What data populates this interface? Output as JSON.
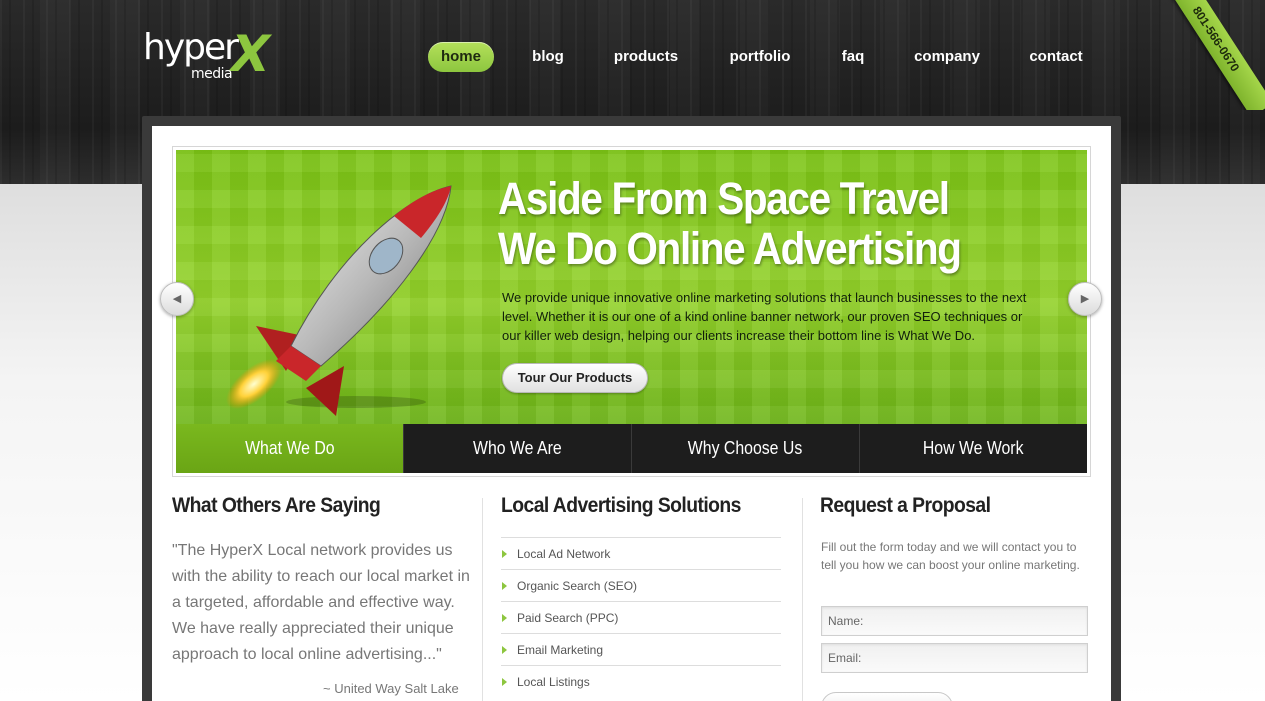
{
  "brand": {
    "logo_main": "hyper",
    "logo_x": "X",
    "logo_sub": "media",
    "phone": "801-566-0670",
    "accent_color": "#8dc63f"
  },
  "nav": {
    "items": [
      "home",
      "blog",
      "products",
      "portfolio",
      "faq",
      "company",
      "contact"
    ],
    "active": "home"
  },
  "slider": {
    "heading_line1": "Aside From Space Travel",
    "heading_line2": "We Do Online Advertising",
    "text": "We provide unique innovative online marketing solutions that launch businesses to the next level. Whether it is our one of a kind online banner network, our proven SEO techniques or our killer web design, helping our clients increase their bottom line is What We Do.",
    "button_label": "Tour Our Products",
    "prev_icon": "arrow-left-icon",
    "next_icon": "arrow-right-icon"
  },
  "tabs": [
    "What We Do",
    "Who We Are",
    "Why Choose Us",
    "How We Work"
  ],
  "testimonials": {
    "title": "What Others Are Saying",
    "quote": "\"The HyperX Local network provides us with the ability to reach our local market in a targeted, affordable and effective way. We have really appreciated their unique approach to local online advertising...\"",
    "source": "~ United Way Salt Lake"
  },
  "solutions": {
    "title": "Local Advertising Solutions",
    "items": [
      "Local Ad Network",
      "Organic Search (SEO)",
      "Paid Search (PPC)",
      "Email Marketing",
      "Local Listings"
    ]
  },
  "proposal": {
    "title": "Request a Proposal",
    "text": "Fill out the form today and we will contact you to tell you how we can boost your online marketing.",
    "name_placeholder": "Name:",
    "email_placeholder": "Email:"
  }
}
